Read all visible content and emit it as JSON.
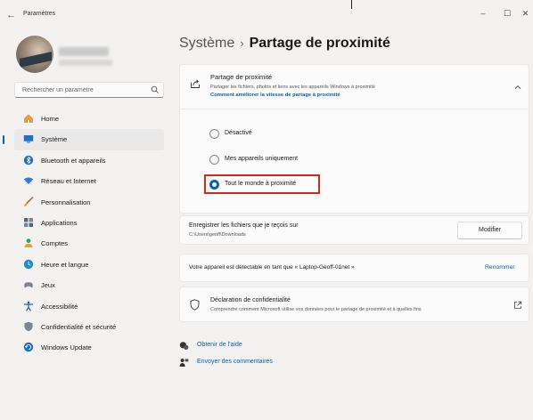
{
  "window": {
    "title": "Paramètres",
    "back_glyph": "←",
    "minimize_glyph": "–",
    "maximize_glyph": "☐",
    "close_glyph": "✕"
  },
  "search": {
    "placeholder": "Rechercher un paramètre",
    "icon": "search-icon"
  },
  "sidebar": {
    "items": [
      {
        "label": "Home",
        "icon": "home-icon",
        "color": "#e8a23a"
      },
      {
        "label": "Système",
        "icon": "monitor-icon",
        "color": "#1f6fc4",
        "active": true
      },
      {
        "label": "Bluetooth et appareils",
        "icon": "bluetooth-icon",
        "color": "#1f6fc4"
      },
      {
        "label": "Réseau et Internet",
        "icon": "wifi-icon",
        "color": "#2b7ad6"
      },
      {
        "label": "Personnalisation",
        "icon": "brush-icon",
        "color": "#c2692c"
      },
      {
        "label": "Applications",
        "icon": "apps-icon",
        "color": "#5a6577"
      },
      {
        "label": "Comptes",
        "icon": "user-icon",
        "color": "#2ea66a"
      },
      {
        "label": "Heure et langue",
        "icon": "globe-clock-icon",
        "color": "#1f8fc4"
      },
      {
        "label": "Jeux",
        "icon": "gamepad-icon",
        "color": "#7a8593"
      },
      {
        "label": "Accessibilité",
        "icon": "accessibility-icon",
        "color": "#1f5fb0"
      },
      {
        "label": "Confidentialité et sécurité",
        "icon": "shield-icon",
        "color": "#7a8593"
      },
      {
        "label": "Windows Update",
        "icon": "update-icon",
        "color": "#1f6fc4"
      }
    ]
  },
  "breadcrumb": {
    "parent": "Système",
    "separator": "›",
    "current": "Partage de proximité"
  },
  "share": {
    "title": "Partage de proximité",
    "description": "Partager les fichiers, photos et liens avec les appareils Windows à proximité",
    "link": "Comment améliorer la vitesse de partage à proximité",
    "options": [
      {
        "label": "Désactivé",
        "selected": false
      },
      {
        "label": "Mes appareils uniquement",
        "selected": false
      },
      {
        "label": "Tout le monde à proximité",
        "selected": true
      }
    ]
  },
  "folder": {
    "title": "Enregistrer les fichiers que je reçois sur",
    "path": "C:\\Users\\geoff\\Downloads",
    "button": "Modifier"
  },
  "device": {
    "text": "Votre appareil est détectable en tant que « Laptop-Geoff-01net »",
    "link": "Renommer"
  },
  "privacy": {
    "title": "Déclaration de confidentialité",
    "description": "Comprendre comment Microsoft utilise vos données pour le partage de proximité et à quelles fins"
  },
  "help_links": [
    {
      "label": "Obtenir de l'aide",
      "icon": "help-icon"
    },
    {
      "label": "Envoyer des commentaires",
      "icon": "feedback-icon"
    }
  ],
  "colors": {
    "accent": "#0a5fb8",
    "highlight": "#d12a1c"
  }
}
